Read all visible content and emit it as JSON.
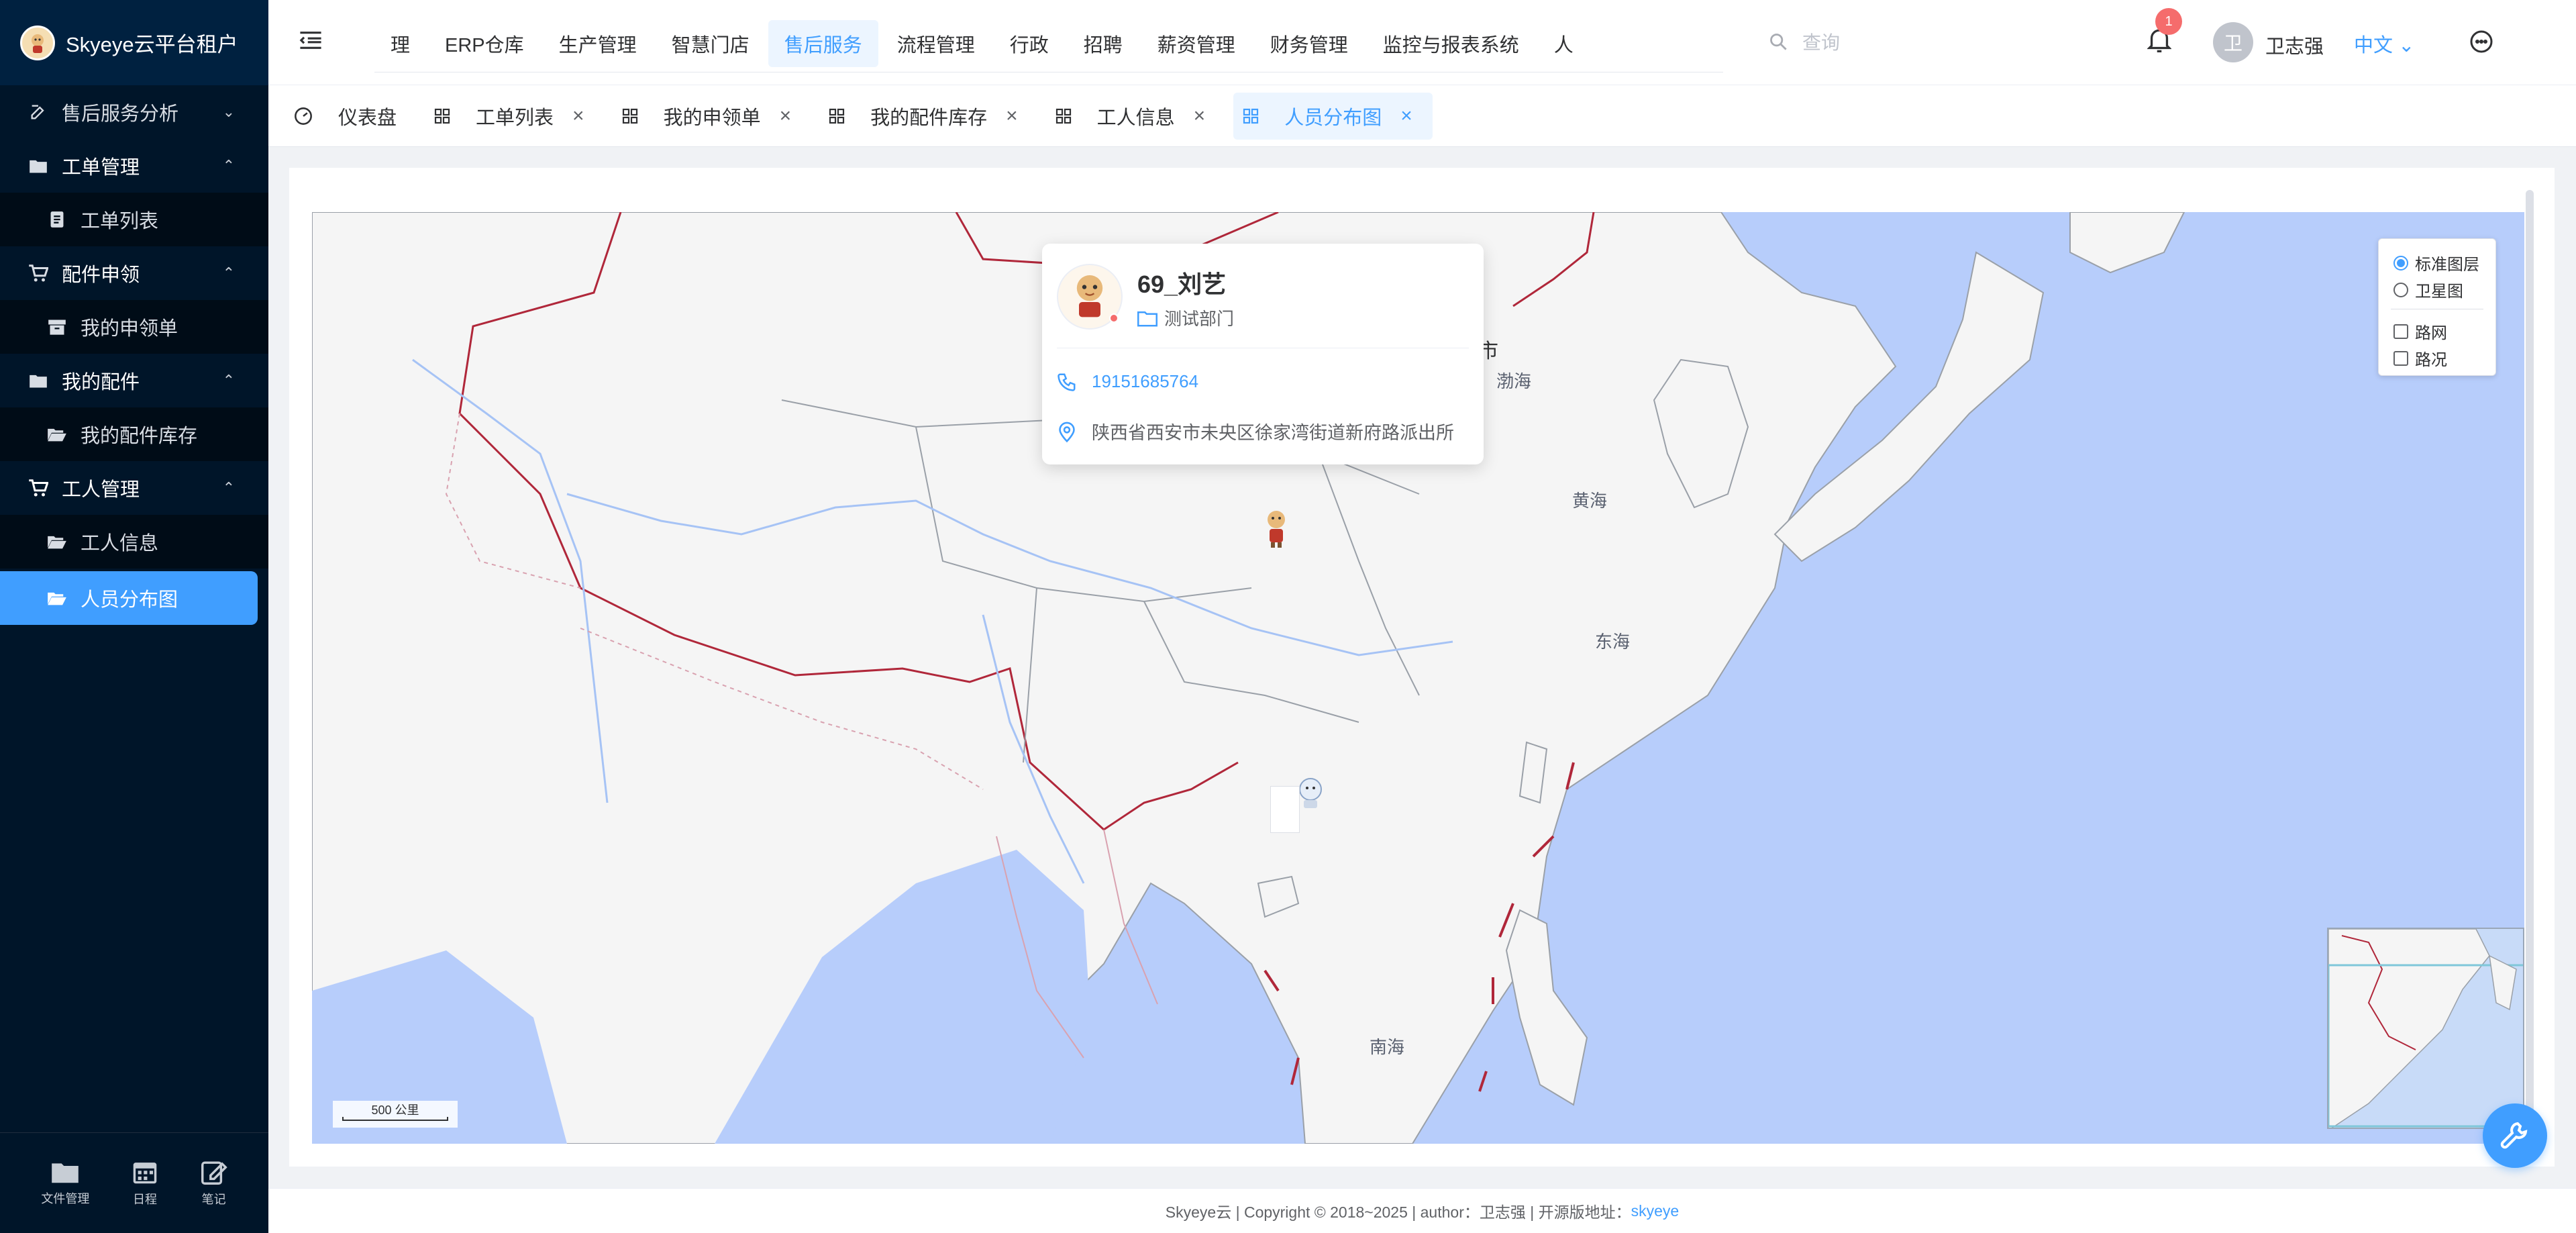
{
  "app": {
    "title": "Skyeye云平台租户"
  },
  "sidebar": {
    "items": [
      {
        "label": "售后服务分析",
        "icon": "edit-icon",
        "type": "group",
        "expanded": false
      },
      {
        "label": "工单管理",
        "icon": "folder-icon",
        "type": "group",
        "expanded": true
      },
      {
        "label": "工单列表",
        "icon": "document-icon",
        "type": "sub"
      },
      {
        "label": "配件申领",
        "icon": "cart-icon",
        "type": "group",
        "expanded": true
      },
      {
        "label": "我的申领单",
        "icon": "archive-icon",
        "type": "sub"
      },
      {
        "label": "我的配件",
        "icon": "folder-icon",
        "type": "group",
        "expanded": true
      },
      {
        "label": "我的配件库存",
        "icon": "folder-open-icon",
        "type": "sub"
      },
      {
        "label": "工人管理",
        "icon": "cart-icon",
        "type": "group",
        "expanded": true
      },
      {
        "label": "工人信息",
        "icon": "folder-open-icon",
        "type": "sub"
      },
      {
        "label": "人员分布图",
        "icon": "folder-open-icon",
        "type": "sub",
        "active": true
      }
    ],
    "bottom": [
      {
        "label": "文件管理",
        "icon": "folder-icon"
      },
      {
        "label": "日程",
        "icon": "calendar-icon"
      },
      {
        "label": "笔记",
        "icon": "note-edit-icon"
      }
    ]
  },
  "header": {
    "nav": [
      "理",
      "ERP仓库",
      "生产管理",
      "智慧门店",
      "售后服务",
      "流程管理",
      "行政",
      "招聘",
      "薪资管理",
      "财务管理",
      "监控与报表系统",
      "人"
    ],
    "active_nav": "售后服务",
    "search_placeholder": "查询",
    "notification_count": "1",
    "avatar_text": "卫",
    "username": "卫志强",
    "language": "中文"
  },
  "tabs": [
    {
      "label": "仪表盘",
      "icon": "dashboard-icon",
      "closable": false
    },
    {
      "label": "工单列表",
      "icon": "grid-icon",
      "closable": true
    },
    {
      "label": "我的申领单",
      "icon": "grid-icon",
      "closable": true
    },
    {
      "label": "我的配件库存",
      "icon": "grid-icon",
      "closable": true
    },
    {
      "label": "工人信息",
      "icon": "grid-icon",
      "closable": true
    },
    {
      "label": "人员分布图",
      "icon": "grid-icon",
      "closable": true,
      "active": true
    }
  ],
  "map": {
    "labels": [
      "渤海",
      "黄海",
      "东海",
      "南海",
      "市"
    ],
    "scale": "500 公里",
    "layer_panel": {
      "standard": "标准图层",
      "satellite": "卫星图",
      "roadnet": "路网",
      "traffic": "路况",
      "selected": "标准图层"
    },
    "info_window": {
      "name": "69_刘艺",
      "department": "测试部门",
      "phone": "19151685764",
      "address": "陕西省西安市未央区徐家湾街道新府路派出所"
    },
    "colors": {
      "sea": "#b7cdfb",
      "land": "#f5f5f5",
      "border": "#b0273a",
      "accent": "#409eff"
    }
  },
  "footer": {
    "text": "Skyeye云 | Copyright © 2018~2025 | author：卫志强 | 开源版地址：",
    "link": "skyeye"
  }
}
